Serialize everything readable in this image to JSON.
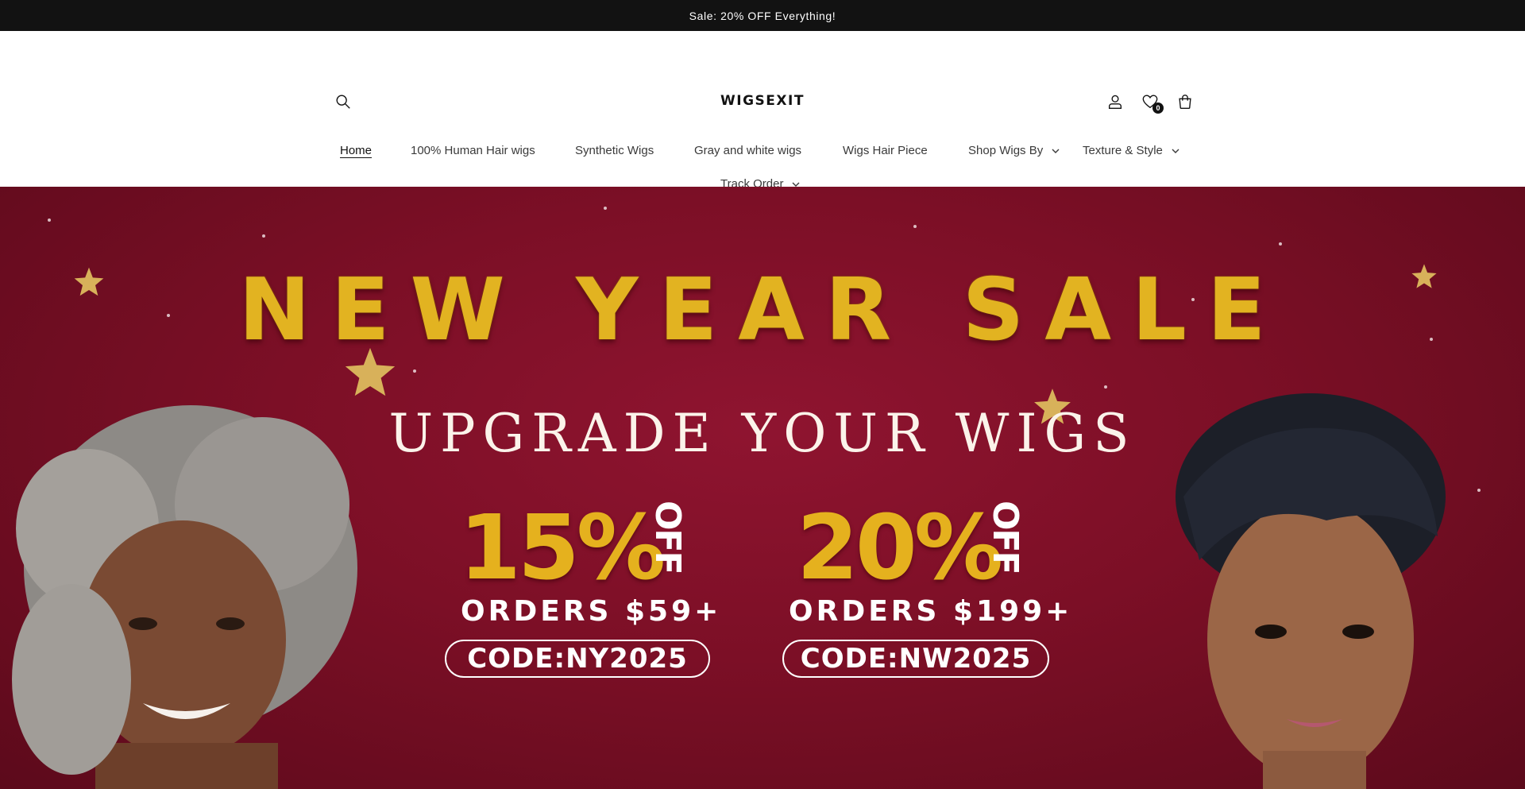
{
  "announcement": {
    "text": "Sale: 20% OFF Everything!"
  },
  "header": {
    "logo": "WIGSEXIT",
    "wishlist_count": "0",
    "icons": {
      "search": "search-icon",
      "account": "account-icon",
      "wishlist": "heart-icon",
      "cart": "cart-icon"
    }
  },
  "nav": {
    "items": [
      {
        "label": "Home",
        "active": true,
        "dropdown": false
      },
      {
        "label": "100% Human Hair wigs",
        "dropdown": false
      },
      {
        "label": "Synthetic Wigs",
        "dropdown": false
      },
      {
        "label": "Gray and white wigs",
        "dropdown": false
      },
      {
        "label": "Wigs Hair Piece",
        "dropdown": false
      },
      {
        "label": "Shop Wigs By",
        "dropdown": true
      },
      {
        "label": "Texture & Style",
        "dropdown": true
      },
      {
        "label": "Track Order",
        "dropdown": true
      }
    ]
  },
  "hero": {
    "title": "NEW YEAR SALE",
    "subtitle": "UPGRADE YOUR WIGS",
    "offers": [
      {
        "percent": "15%",
        "off": "OFF",
        "orders": "ORDERS $59+",
        "code": "CODE:NY2025"
      },
      {
        "percent": "20%",
        "off": "OFF",
        "orders": "ORDERS $199+",
        "code": "CODE:NW2025"
      }
    ]
  },
  "colors": {
    "announcement_bg": "#121212",
    "hero_bg": "#7c0f26",
    "gold": "#e2b321",
    "white": "#ffffff"
  }
}
